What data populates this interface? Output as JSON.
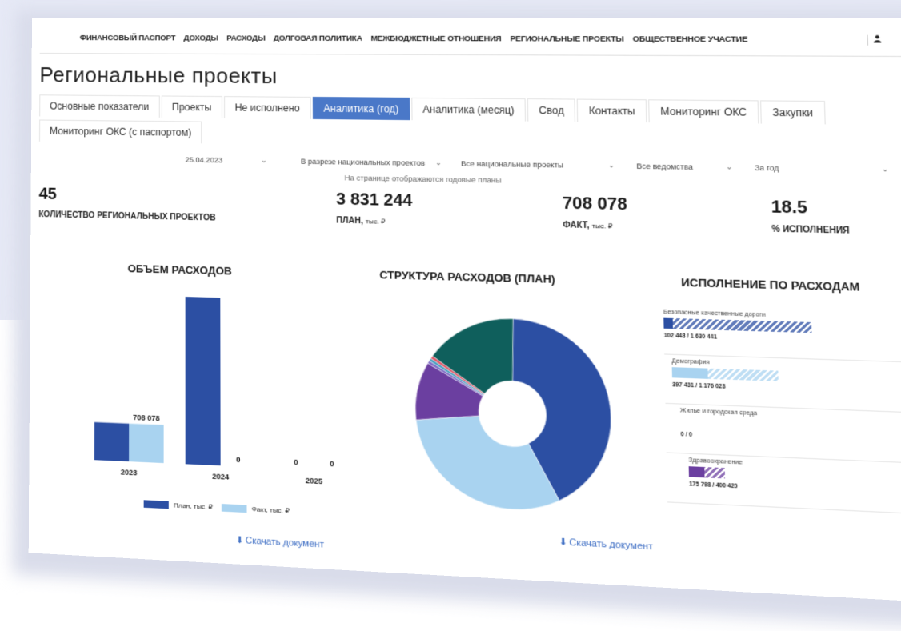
{
  "nav": {
    "items": [
      "ФИНАНСОВЫЙ ПАСПОРТ",
      "ДОХОДЫ",
      "РАСХОДЫ",
      "ДОЛГОВАЯ ПОЛИТИКА",
      "МЕЖБЮДЖЕТНЫЕ ОТНОШЕНИЯ",
      "РЕГИОНАЛЬНЫЕ ПРОЕКТЫ",
      "ОБЩЕСТВЕННОЕ УЧАСТИЕ"
    ]
  },
  "page_title": "Региональные проекты",
  "tabs": [
    "Основные показатели",
    "Проекты",
    "Не исполнено",
    "Аналитика (год)",
    "Аналитика (месяц)",
    "Свод",
    "Контакты",
    "Мониторинг ОКС",
    "Закупки",
    "Мониторинг ОКС (с паспортом)"
  ],
  "active_tab": "Аналитика (год)",
  "filters": {
    "date": "25.04.2023",
    "grouping": "В разрезе национальных проектов",
    "projects": "Все национальные проекты",
    "departments": "Все ведомства",
    "period": "За год"
  },
  "notice": "На странице отображаются годовые планы",
  "kpis": {
    "count": {
      "value": "45",
      "label": "КОЛИЧЕСТВО РЕГИОНАЛЬНЫХ ПРОЕКТОВ"
    },
    "plan": {
      "value": "3 831 244",
      "label": "ПЛАН,",
      "unit": "тыс. ₽"
    },
    "fact": {
      "value": "708 078",
      "label": "ФАКТ,",
      "unit": "тыс. ₽"
    },
    "percent": {
      "value": "18.5",
      "label": "% ИСПОЛНЕНИЯ"
    }
  },
  "sections": {
    "volume": "ОБЪЕМ РАСХОДОВ",
    "structure": "СТРУКТУРА РАСХОДОВ (ПЛАН)",
    "execution": "ИСПОЛНЕНИЕ ПО РАСХОДАМ"
  },
  "download_label": "Скачать документ",
  "colors": {
    "plan": "#2c4fa3",
    "fact": "#a9d3f0",
    "accent": "#4a78c8"
  },
  "chart_data": [
    {
      "type": "bar",
      "title": "ОБЪЕМ РАСХОДОВ",
      "categories": [
        "2023",
        "2024",
        "2025"
      ],
      "series": [
        {
          "name": "План, тыс. ₽",
          "values": [
            708078,
            3123166,
            0
          ]
        },
        {
          "name": "Факт, тыс. ₽",
          "values": [
            708078,
            0,
            0
          ]
        }
      ],
      "data_labels": [
        {
          "category": "2023",
          "series": "Факт, тыс. ₽",
          "text": "708 078"
        },
        {
          "category": "2024",
          "series": "Факт, тыс. ₽",
          "text": "0"
        },
        {
          "category": "2025",
          "series": "План, тыс. ₽",
          "text": "0"
        },
        {
          "category": "2025",
          "series": "Факт, тыс. ₽",
          "text": "0"
        }
      ],
      "legend": "bottom"
    },
    {
      "type": "pie",
      "title": "СТРУКТУРА РАСХОДОВ (ПЛАН)",
      "slices": [
        {
          "value": 42,
          "color": "#2c4fa3"
        },
        {
          "value": 31,
          "color": "#a9d3f0"
        },
        {
          "value": 10,
          "color": "#6b3fa0"
        },
        {
          "value": 0.5,
          "color": "#7e6cc4"
        },
        {
          "value": 0.5,
          "color": "#4aa0c0"
        },
        {
          "value": 0.5,
          "color": "#e05a6a"
        },
        {
          "value": 15.5,
          "color": "#0f5f5c"
        }
      ]
    },
    {
      "type": "bar",
      "title": "ИСПОЛНЕНИЕ ПО РАСХОДАМ",
      "items": [
        {
          "name": "Безопасные качественные дороги",
          "fact": 102443,
          "plan": 1630441,
          "label": "102 443 / 1 630 441",
          "color": "#2c4fa3"
        },
        {
          "name": "Демография",
          "fact": 397431,
          "plan": 1176023,
          "label": "397 431 / 1 176 023",
          "color": "#a9d3f0"
        },
        {
          "name": "Жилье и городская среда",
          "fact": 0,
          "plan": 0,
          "label": "0 / 0",
          "color": "#888888"
        },
        {
          "name": "Здравоохранение",
          "fact": 175798,
          "plan": 400420,
          "label": "175 798 / 400 420",
          "color": "#6b3fa0"
        }
      ]
    }
  ]
}
